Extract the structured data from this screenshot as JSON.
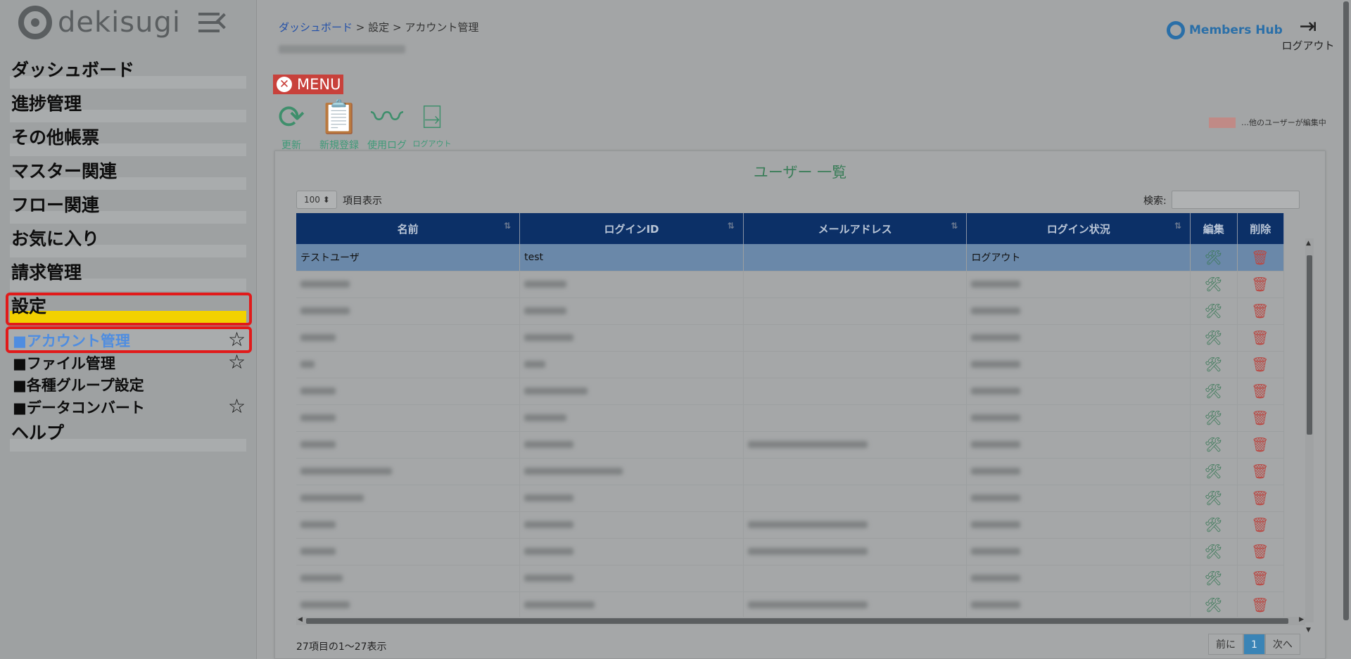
{
  "sidebar": {
    "logo_text": "dekisugi",
    "items": [
      {
        "label": "ダッシュボード"
      },
      {
        "label": "進捗管理"
      },
      {
        "label": "その他帳票"
      },
      {
        "label": "マスター関連"
      },
      {
        "label": "フロー関連"
      },
      {
        "label": "お気に入り"
      },
      {
        "label": "請求管理"
      },
      {
        "label": "設定"
      },
      {
        "label": "ヘルプ"
      }
    ],
    "sub_items": [
      {
        "label": "■アカウント管理",
        "starred": true
      },
      {
        "label": "■ファイル管理",
        "starred": true
      },
      {
        "label": "■各種グループ設定",
        "starred": false
      },
      {
        "label": "■データコンバート",
        "starred": true
      }
    ]
  },
  "header": {
    "breadcrumb": {
      "home": "ダッシュボード",
      "sep": ">",
      "level1": "設定",
      "level2": "アカウント管理"
    },
    "brand": "Members Hub",
    "logout_label": "ログアウト"
  },
  "toolbar": {
    "menu_label": "MENU",
    "refresh_label": "更新",
    "new_label": "新規登録",
    "log_label": "使用ログ",
    "logout_label": "ログアウト"
  },
  "legend": {
    "text": "…他のユーザーが編集中",
    "color": "#c08a86"
  },
  "panel": {
    "title": "ユーザー 一覧",
    "length_value": "100",
    "length_label": "項目表示",
    "search_label": "検索:",
    "columns": [
      "名前",
      "ログインID",
      "メールアドレス",
      "ログイン状況",
      "編集",
      "削除"
    ],
    "first_row": {
      "name": "テストユーザ",
      "login_id": "test",
      "email": "",
      "status": "ログアウト"
    },
    "info": "27項目の1～27表示",
    "pager": {
      "prev": "前に",
      "current": "1",
      "next": "次へ"
    }
  },
  "colors": {
    "header_bg": "#0c3067",
    "active_bar": "#f2d100",
    "highlight": "#e11a1a",
    "selected_row": "#6a88a9"
  }
}
